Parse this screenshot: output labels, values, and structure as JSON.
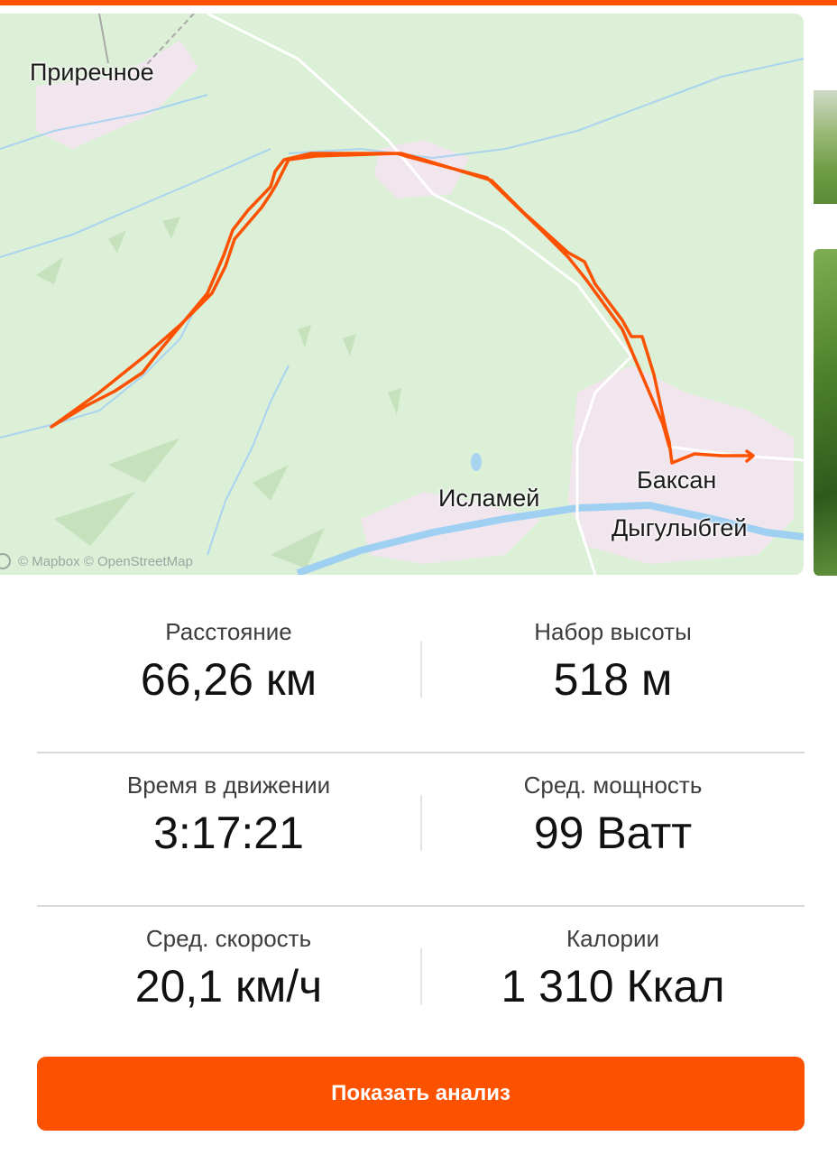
{
  "map": {
    "places": {
      "prirechnoe": "Приречное",
      "baksan": "Баксан",
      "islamey": "Исламей",
      "dygulybgey": "Дыгулыбгей"
    },
    "attribution": "© Mapbox © OpenStreetMap",
    "colors": {
      "route": "#fc5200",
      "water": "#a9d4f0",
      "land": "#dcefd7",
      "settlement": "#f2e6ee"
    }
  },
  "stats": {
    "distance": {
      "label": "Расстояние",
      "value": "66,26 км"
    },
    "elevation": {
      "label": "Набор высоты",
      "value": "518 м"
    },
    "moving_time": {
      "label": "Время в движении",
      "value": "3:17:21"
    },
    "avg_power": {
      "label": "Сред. мощность",
      "value": "99 Ватт"
    },
    "avg_speed": {
      "label": "Сред. скорость",
      "value": "20,1 км/ч"
    },
    "calories": {
      "label": "Калории",
      "value": "1 310 Ккал"
    }
  },
  "button": {
    "label": "Показать анализ"
  },
  "colors": {
    "accent": "#fc5200"
  }
}
